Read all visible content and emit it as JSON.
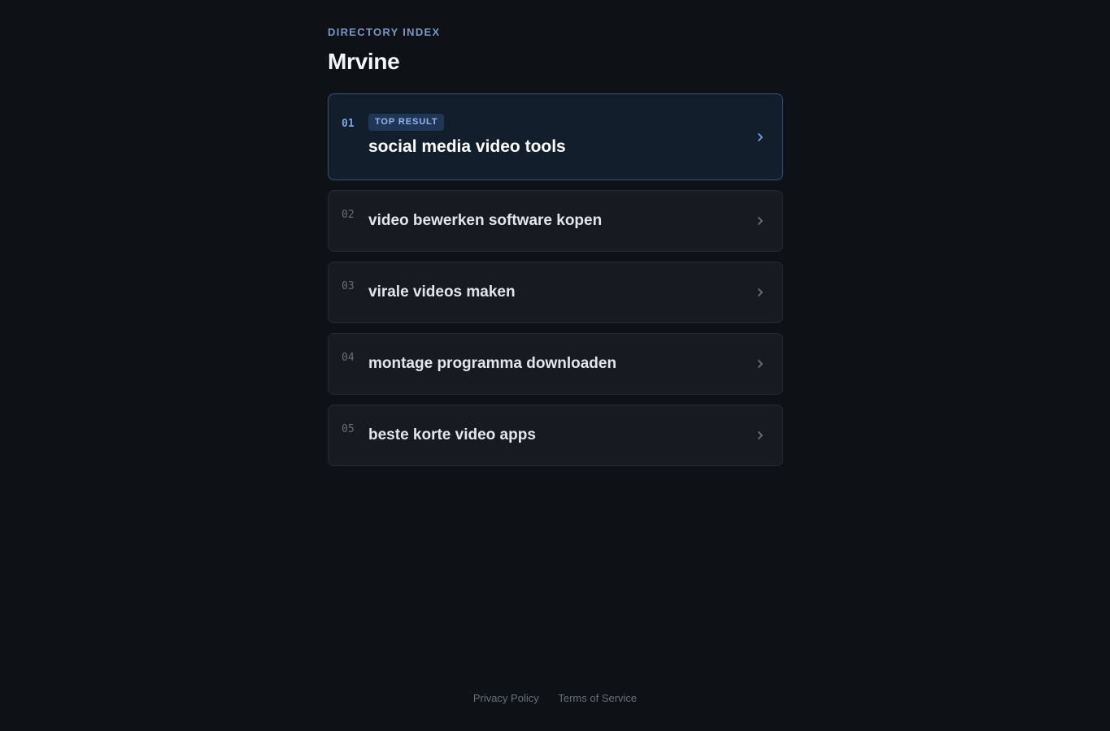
{
  "header": {
    "eyebrow": "DIRECTORY INDEX",
    "title": "Mrvine"
  },
  "results": [
    {
      "num": "01",
      "label": "social media video tools",
      "badge": "TOP RESULT",
      "top": true
    },
    {
      "num": "02",
      "label": "video bewerken software kopen"
    },
    {
      "num": "03",
      "label": "virale videos maken"
    },
    {
      "num": "04",
      "label": "montage programma downloaden"
    },
    {
      "num": "05",
      "label": "beste korte video apps"
    }
  ],
  "footer": {
    "privacy": "Privacy Policy",
    "terms": "Terms of Service"
  },
  "colors": {
    "background": "#0e1115",
    "accent": "#7aa2e0",
    "top_card_background": "#121e2c",
    "card_background": "#171a20"
  },
  "icons": {
    "row_action": "chevron-right-icon"
  }
}
